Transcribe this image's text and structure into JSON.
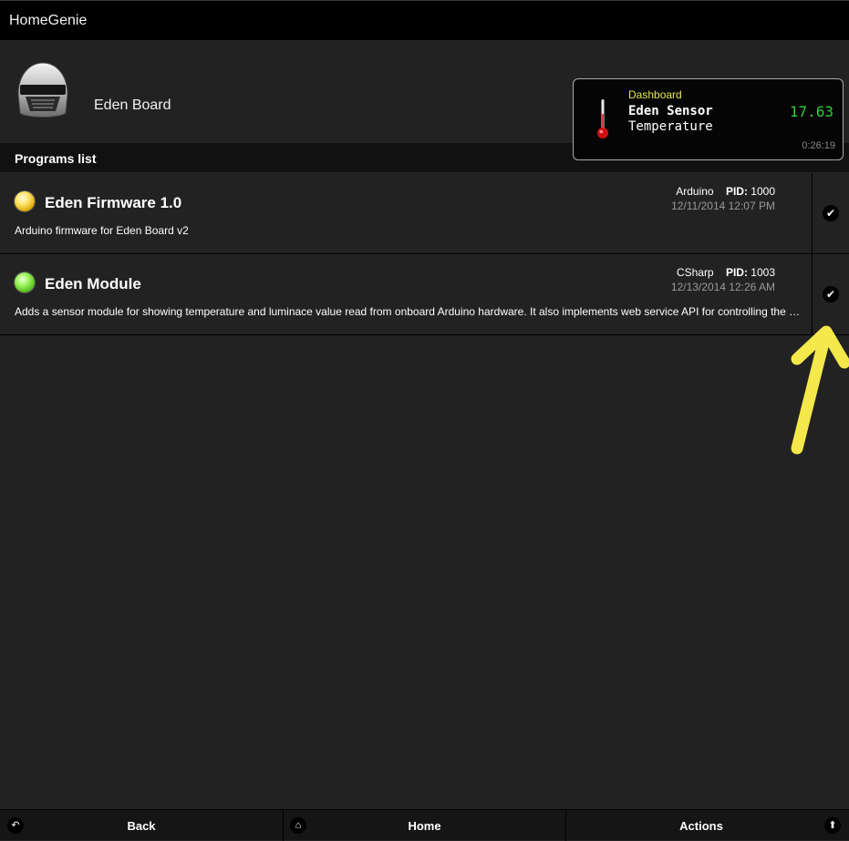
{
  "app": {
    "title": "HomeGenie"
  },
  "module": {
    "name": "Eden Board"
  },
  "notification": {
    "source": "Dashboard",
    "name": "Eden Sensor",
    "property": "Temperature",
    "value": "17.63",
    "time": "0:26:19",
    "icon": "thermometer-icon"
  },
  "programs": {
    "title": "Programs list",
    "pid_label": "PID:",
    "items": [
      {
        "name": "Eden Firmware 1.0",
        "description": "Arduino firmware for Eden Board v2",
        "language": "Arduino",
        "pid": "1000",
        "date": "12/11/2014 12:07 PM",
        "status_color": "yellow",
        "action_icon": "check-icon"
      },
      {
        "name": "Eden Module",
        "description": "Adds a sensor module for showing temperature and luminace value read from onboard Arduino hardware. It also implements web service API for controlling the board via HTTP.",
        "language": "CSharp",
        "pid": "1003",
        "date": "12/13/2014 12:26 AM",
        "status_color": "green",
        "action_icon": "check-icon"
      }
    ]
  },
  "footer": {
    "back": "Back",
    "home": "Home",
    "actions": "Actions"
  },
  "colors": {
    "background": "#222222",
    "bar": "#000000",
    "notification_source": "#e8e84a",
    "notification_value": "#33cc33",
    "annotation_arrow": "#f4e84a"
  }
}
